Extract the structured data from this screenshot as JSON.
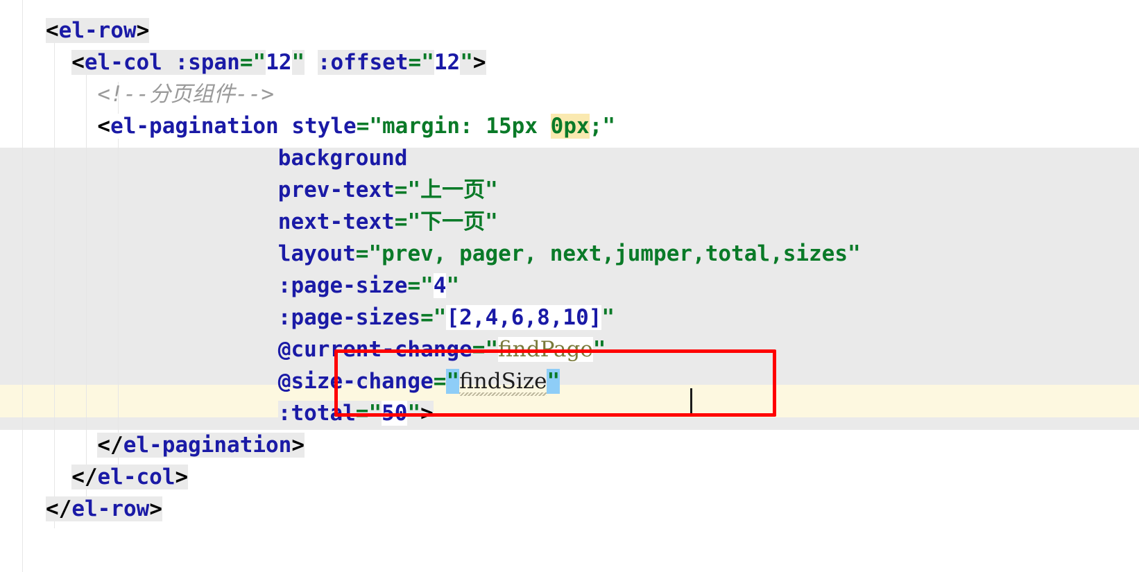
{
  "editor": {
    "language": "vue-html",
    "colors": {
      "tag_bracket": "#000000",
      "tag_name": "#1a1aa6",
      "attribute": "#1a1aa6",
      "string": "#0a7a28",
      "number": "#1a1aa6",
      "comment": "#9a9a9a",
      "identifier": "#7a7a3a",
      "block_highlight": "#eaeaea",
      "caret_line": "#fdf8e0",
      "selection": "#8ecdf7",
      "search_match": "#fae9b0",
      "annotation_box": "#ff0000",
      "background": "#ffffff"
    },
    "caret": {
      "line": 11,
      "column": 39,
      "after_text": "findSize"
    }
  },
  "annotation": {
    "type": "red-rectangle",
    "covers_lines": [
      10,
      11
    ],
    "color": "#ff0000"
  },
  "code": {
    "lines": [
      {
        "n": 1,
        "indent": "",
        "text": "<el-row>",
        "tokens": [
          {
            "t": "<",
            "c": "tag",
            "bg": "gray"
          },
          {
            "t": "el-row",
            "c": "name",
            "bg": "gray"
          },
          {
            "t": ">",
            "c": "tag",
            "bg": "gray"
          }
        ]
      },
      {
        "n": 2,
        "indent": "  ",
        "text": "<el-col :span=\"12\" :offset=\"12\">",
        "tokens": [
          {
            "t": "<",
            "c": "tag",
            "bg": "gray"
          },
          {
            "t": "el-col ",
            "c": "name",
            "bg": "gray"
          },
          {
            "t": ":span",
            "c": "name",
            "bg": "gray"
          },
          {
            "t": "=",
            "c": "eq",
            "bg": "gray"
          },
          {
            "t": "\"",
            "c": "str",
            "bg": "gray"
          },
          {
            "t": "12",
            "c": "num",
            "bg": "white"
          },
          {
            "t": "\"",
            "c": "str",
            "bg": "gray"
          },
          {
            "t": " ",
            "c": "tag",
            "bg": "none"
          },
          {
            "t": ":offset",
            "c": "name",
            "bg": "gray"
          },
          {
            "t": "=",
            "c": "eq",
            "bg": "gray"
          },
          {
            "t": "\"",
            "c": "str",
            "bg": "gray"
          },
          {
            "t": "12",
            "c": "num",
            "bg": "white"
          },
          {
            "t": "\"",
            "c": "str",
            "bg": "gray"
          },
          {
            "t": ">",
            "c": "tag",
            "bg": "gray"
          }
        ]
      },
      {
        "n": 3,
        "indent": "    ",
        "text": "<!--分页组件-->",
        "tokens": [
          {
            "t": "<!--分页组件-->",
            "c": "comment",
            "bg": "none"
          }
        ]
      },
      {
        "n": 4,
        "indent": "    ",
        "text": "<el-pagination style=\"margin: 15px 0px;\"",
        "tokens": [
          {
            "t": "<",
            "c": "tag",
            "bg": "white"
          },
          {
            "t": "el-pagination ",
            "c": "name",
            "bg": "white"
          },
          {
            "t": "style",
            "c": "name",
            "bg": "white"
          },
          {
            "t": "=",
            "c": "eq",
            "bg": "white"
          },
          {
            "t": "\"margin: 15px ",
            "c": "str",
            "bg": "white"
          },
          {
            "t": "0px",
            "c": "str",
            "bg": "amber"
          },
          {
            "t": ";\"",
            "c": "str",
            "bg": "white"
          }
        ]
      },
      {
        "n": 5,
        "indent": "                  ",
        "text": "background",
        "tokens": [
          {
            "t": "background",
            "c": "name",
            "bg": "none"
          }
        ]
      },
      {
        "n": 6,
        "indent": "                  ",
        "text": "prev-text=\"上一页\"",
        "tokens": [
          {
            "t": "prev-text",
            "c": "name",
            "bg": "none"
          },
          {
            "t": "=",
            "c": "eq",
            "bg": "none"
          },
          {
            "t": "\"上一页\"",
            "c": "str",
            "bg": "none"
          }
        ]
      },
      {
        "n": 7,
        "indent": "                  ",
        "text": "next-text=\"下一页\"",
        "tokens": [
          {
            "t": "next-text",
            "c": "name",
            "bg": "none"
          },
          {
            "t": "=",
            "c": "eq",
            "bg": "none"
          },
          {
            "t": "\"下一页\"",
            "c": "str",
            "bg": "none"
          }
        ]
      },
      {
        "n": 8,
        "indent": "                  ",
        "text": "layout=\"prev, pager, next,jumper,total,sizes\"",
        "tokens": [
          {
            "t": "layout",
            "c": "name",
            "bg": "none"
          },
          {
            "t": "=",
            "c": "eq",
            "bg": "none"
          },
          {
            "t": "\"prev, pager, next,jumper,total,sizes\"",
            "c": "str",
            "bg": "none"
          }
        ]
      },
      {
        "n": 9,
        "indent": "                  ",
        "text": ":page-size=\"4\"",
        "tokens": [
          {
            "t": ":page-size",
            "c": "name",
            "bg": "none"
          },
          {
            "t": "=",
            "c": "eq",
            "bg": "none"
          },
          {
            "t": "\"",
            "c": "str",
            "bg": "none"
          },
          {
            "t": "4",
            "c": "num",
            "bg": "white"
          },
          {
            "t": "\"",
            "c": "str",
            "bg": "none"
          }
        ]
      },
      {
        "n": 10,
        "indent": "                  ",
        "text": ":page-sizes=\"[2,4,6,8,10]\"",
        "tokens": [
          {
            "t": ":page-sizes",
            "c": "name",
            "bg": "none"
          },
          {
            "t": "=",
            "c": "eq",
            "bg": "none"
          },
          {
            "t": "\"",
            "c": "str",
            "bg": "none"
          },
          {
            "t": "[2,4,6,8,10]",
            "c": "num",
            "bg": "white"
          },
          {
            "t": "\"",
            "c": "str",
            "bg": "none"
          }
        ]
      },
      {
        "n": 11,
        "indent": "                  ",
        "text": "@current-change=\"findPage\"",
        "boxed": true,
        "tokens": [
          {
            "t": "@current-change",
            "c": "name",
            "bg": "none"
          },
          {
            "t": "=",
            "c": "eq",
            "bg": "none"
          },
          {
            "t": "\"",
            "c": "str",
            "bg": "none"
          },
          {
            "t": "findPage",
            "c": "ident",
            "bg": "white"
          },
          {
            "t": "\"",
            "c": "str",
            "bg": "none"
          }
        ]
      },
      {
        "n": 12,
        "indent": "                  ",
        "text": "@size-change=\"findSize\"",
        "boxed": true,
        "caret_line": true,
        "tokens": [
          {
            "t": "@size-change",
            "c": "name",
            "bg": "none"
          },
          {
            "t": "=",
            "c": "eq",
            "bg": "none"
          },
          {
            "t": "\"",
            "c": "str",
            "bg": "sel"
          },
          {
            "t": "findSize",
            "c": "ident-dk",
            "bg": "none",
            "squiggle": true
          },
          {
            "t": "\"",
            "c": "str",
            "bg": "sel"
          }
        ]
      },
      {
        "n": 13,
        "indent": "                  ",
        "text": ":total=\"50\">",
        "tokens": [
          {
            "t": ":total",
            "c": "name",
            "bg": "gray"
          },
          {
            "t": "=",
            "c": "eq",
            "bg": "gray"
          },
          {
            "t": "\"",
            "c": "str",
            "bg": "gray"
          },
          {
            "t": "50",
            "c": "num",
            "bg": "white"
          },
          {
            "t": "\"",
            "c": "str",
            "bg": "gray"
          },
          {
            "t": ">",
            "c": "tag",
            "bg": "gray"
          }
        ]
      },
      {
        "n": 14,
        "indent": "    ",
        "text": "</el-pagination>",
        "tokens": [
          {
            "t": "</",
            "c": "tag",
            "bg": "gray"
          },
          {
            "t": "el-pagination",
            "c": "name",
            "bg": "gray"
          },
          {
            "t": ">",
            "c": "tag",
            "bg": "gray"
          }
        ]
      },
      {
        "n": 15,
        "indent": "  ",
        "text": "</el-col>",
        "tokens": [
          {
            "t": "</",
            "c": "tag",
            "bg": "gray"
          },
          {
            "t": "el-col",
            "c": "name",
            "bg": "gray"
          },
          {
            "t": ">",
            "c": "tag",
            "bg": "gray"
          }
        ]
      },
      {
        "n": 16,
        "indent": "",
        "text": "</el-row>",
        "tokens": [
          {
            "t": "</",
            "c": "tag",
            "bg": "gray"
          },
          {
            "t": "el-row",
            "c": "name",
            "bg": "gray"
          },
          {
            "t": ">",
            "c": "tag",
            "bg": "gray"
          }
        ]
      }
    ]
  }
}
